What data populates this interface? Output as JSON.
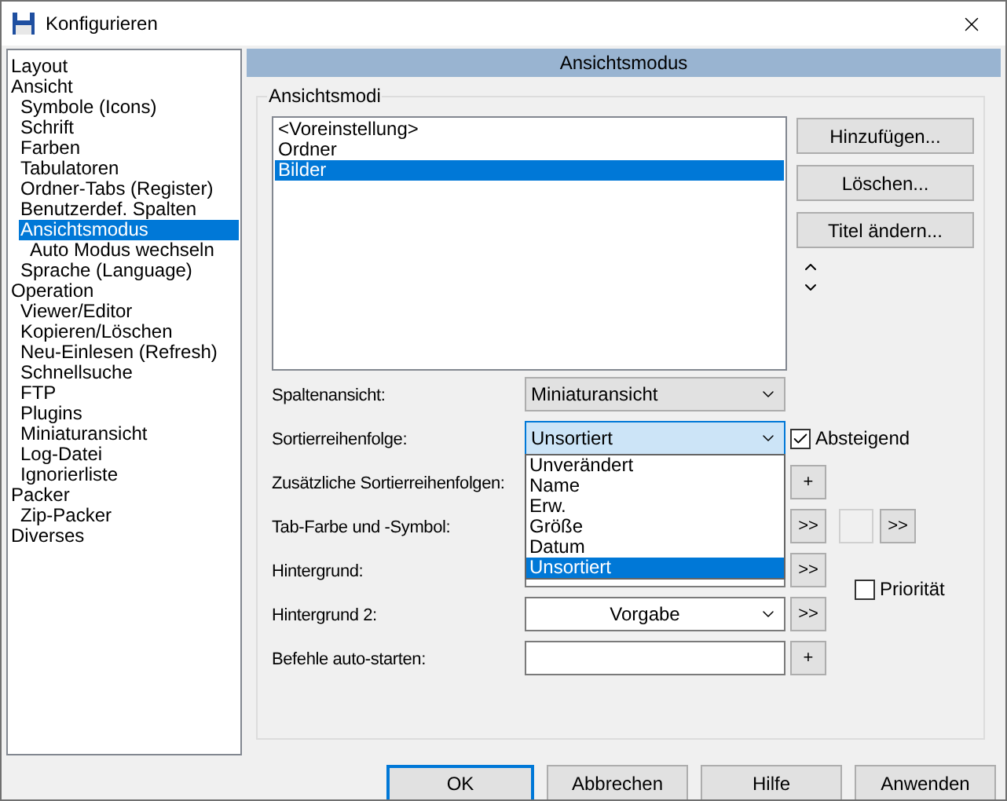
{
  "window": {
    "title": "Konfigurieren"
  },
  "tree": [
    {
      "label": "Layout",
      "selected": false
    },
    {
      "label": "Ansicht",
      "selected": false,
      "children": [
        {
          "label": "Symbole (Icons)",
          "selected": false
        },
        {
          "label": "Schrift",
          "selected": false
        },
        {
          "label": "Farben",
          "selected": false
        },
        {
          "label": "Tabulatoren",
          "selected": false
        },
        {
          "label": "Ordner-Tabs (Register)",
          "selected": false
        },
        {
          "label": "Benutzerdef. Spalten",
          "selected": false
        },
        {
          "label": "Ansichtsmodus",
          "selected": true,
          "children": [
            {
              "label": "Auto Modus wechseln",
              "selected": false
            }
          ]
        },
        {
          "label": "Sprache (Language)",
          "selected": false
        }
      ]
    },
    {
      "label": "Operation",
      "selected": false,
      "children": [
        {
          "label": "Viewer/Editor",
          "selected": false
        },
        {
          "label": "Kopieren/Löschen",
          "selected": false
        },
        {
          "label": "Neu-Einlesen (Refresh)",
          "selected": false
        },
        {
          "label": "Schnellsuche",
          "selected": false
        },
        {
          "label": "FTP",
          "selected": false
        },
        {
          "label": "Plugins",
          "selected": false
        },
        {
          "label": "Miniaturansicht",
          "selected": false
        },
        {
          "label": "Log-Datei",
          "selected": false
        },
        {
          "label": "Ignorierliste",
          "selected": false
        }
      ]
    },
    {
      "label": "Packer",
      "selected": false,
      "children": [
        {
          "label": "Zip-Packer",
          "selected": false
        }
      ]
    },
    {
      "label": "Diverses",
      "selected": false
    }
  ],
  "panel": {
    "title": "Ansichtsmodus",
    "group": {
      "title": "Ansichtsmodi",
      "modes": [
        {
          "label": "<Voreinstellung>",
          "selected": false
        },
        {
          "label": "Ordner",
          "selected": false
        },
        {
          "label": "Bilder",
          "selected": true
        }
      ],
      "buttons": [
        "Hinzufügen...",
        "Löschen...",
        "Titel ändern..."
      ],
      "rows": [
        {
          "kind": "combo",
          "label": "Spaltenansicht:",
          "value": "Miniaturansicht",
          "focused": false
        },
        {
          "kind": "combo",
          "label": "Sortierreihenfolge:",
          "value": "Unsortiert",
          "focused": true,
          "checkbox": {
            "label": "Absteigend",
            "checked": true
          }
        },
        {
          "kind": "hidden",
          "label": "Zusätzliche Sortierreihenfolgen:",
          "button": "+"
        },
        {
          "kind": "hidden_color",
          "label": "Tab-Farbe und -Symbol:",
          "button": ">>",
          "button_2": ">>"
        },
        {
          "kind": "partly_hidden",
          "label": "Hintergrund:",
          "button": ">>",
          "checkbox": {
            "label": "Priorität",
            "checked": false
          }
        },
        {
          "kind": "combo",
          "label": "Hintergrund 2:",
          "value": "Vorgabe",
          "focused": false,
          "centered": true,
          "button": ">>"
        },
        {
          "kind": "input",
          "label": "Befehle auto-starten:",
          "button": "+"
        }
      ],
      "dropdown": {
        "options": [
          {
            "label": "Unverändert",
            "selected": false
          },
          {
            "label": "Name",
            "selected": false
          },
          {
            "label": "Erw.",
            "selected": false
          },
          {
            "label": "Größe",
            "selected": false
          },
          {
            "label": "Datum",
            "selected": false
          },
          {
            "label": "Unsortiert",
            "selected": true
          }
        ]
      }
    }
  },
  "footer": [
    {
      "label": "OK",
      "default": true
    },
    {
      "label": "Abbrechen",
      "default": false
    },
    {
      "label": "Hilfe",
      "default": false
    },
    {
      "label": "Anwenden",
      "default": false
    }
  ]
}
